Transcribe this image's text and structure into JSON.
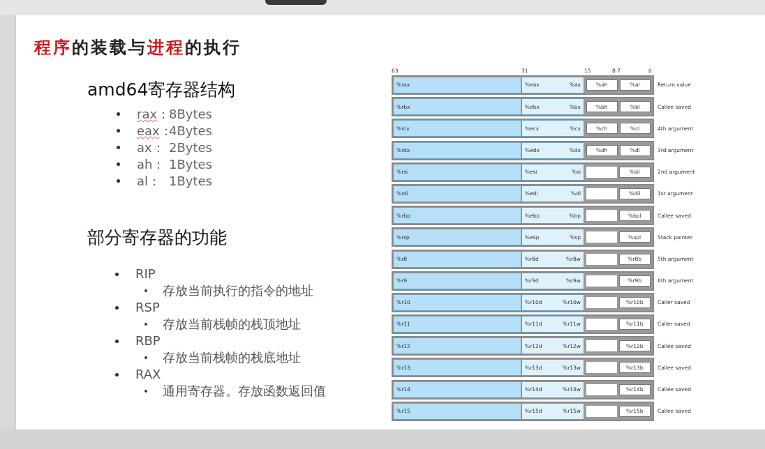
{
  "title": [
    {
      "text": "程序",
      "highlight": true
    },
    {
      "text": "的装载与",
      "highlight": false
    },
    {
      "text": "进程",
      "highlight": true
    },
    {
      "text": "的执行",
      "highlight": false
    }
  ],
  "section_1": {
    "heading": "amd64寄存器结构",
    "items": [
      {
        "name": "rax",
        "sep": "：",
        "value": "8Bytes",
        "misspelled": true
      },
      {
        "name": "eax",
        "sep": "：",
        "value": "4Bytes",
        "misspelled": true
      },
      {
        "name": "ax",
        "sep": "：",
        "value": "2Bytes",
        "misspelled": false
      },
      {
        "name": "ah",
        "sep": "：",
        "value": "1Bytes",
        "misspelled": false
      },
      {
        "name": "al",
        "sep": "：",
        "value": "1Bytes",
        "misspelled": false
      }
    ]
  },
  "section_2": {
    "heading": "部分寄存器的功能",
    "items": [
      {
        "label": "RIP",
        "children": [
          {
            "label": "存放当前执行的指令的地址"
          }
        ]
      },
      {
        "label": "RSP",
        "children": [
          {
            "label": "存放当前栈帧的栈顶地址"
          }
        ]
      },
      {
        "label": "RBP",
        "children": [
          {
            "label": "存放当前栈帧的栈底地址"
          }
        ]
      },
      {
        "label": "RAX",
        "children": [
          {
            "label": "通用寄存器。存放函数返回值"
          }
        ]
      }
    ]
  },
  "diagram": {
    "bit_labels": [
      "63",
      "31",
      "15",
      "8 7",
      "0"
    ],
    "rows": [
      {
        "r64": "%rax",
        "r32": "%eax",
        "r16": "%ax",
        "r8h": "%ah",
        "r8l": "%al",
        "note": "Return value"
      },
      {
        "r64": "%rbx",
        "r32": "%ebx",
        "r16": "%bx",
        "r8h": "%bh",
        "r8l": "%bl",
        "note": "Callee saved"
      },
      {
        "r64": "%rcx",
        "r32": "%ecx",
        "r16": "%cx",
        "r8h": "%ch",
        "r8l": "%cl",
        "note": "4th argument"
      },
      {
        "r64": "%rdx",
        "r32": "%edx",
        "r16": "%dx",
        "r8h": "%dh",
        "r8l": "%dl",
        "note": "3rd argument"
      },
      {
        "r64": "%rsi",
        "r32": "%esi",
        "r16": "%si",
        "r8l": "%sil",
        "note": "2nd argument"
      },
      {
        "r64": "%rdi",
        "r32": "%edi",
        "r16": "%di",
        "r8l": "%dil",
        "note": "1st argument"
      },
      {
        "r64": "%rbp",
        "r32": "%ebp",
        "r16": "%bp",
        "r8l": "%bpl",
        "note": "Callee saved"
      },
      {
        "r64": "%rsp",
        "r32": "%esp",
        "r16": "%sp",
        "r8l": "%spl",
        "note": "Stack pointer"
      },
      {
        "r64": "%r8",
        "r32": "%r8d",
        "r16": "%r8w",
        "r8l": "%r8b",
        "note": "5th argument"
      },
      {
        "r64": "%r9",
        "r32": "%r9d",
        "r16": "%r9w",
        "r8l": "%r9b",
        "note": "6th argument"
      },
      {
        "r64": "%r10",
        "r32": "%r10d",
        "r16": "%r10w",
        "r8l": "%r10b",
        "note": "Caller saved"
      },
      {
        "r64": "%r11",
        "r32": "%r11d",
        "r16": "%r11w",
        "r8l": "%r11b",
        "note": "Caller saved"
      },
      {
        "r64": "%r12",
        "r32": "%r12d",
        "r16": "%r12w",
        "r8l": "%r12b",
        "note": "Callee saved"
      },
      {
        "r64": "%r13",
        "r32": "%r13d",
        "r16": "%r13w",
        "r8l": "%r13b",
        "note": "Callee saved"
      },
      {
        "r64": "%r14",
        "r32": "%r14d",
        "r16": "%r14w",
        "r8l": "%r14b",
        "note": "Callee saved"
      },
      {
        "r64": "%r15",
        "r32": "%r15d",
        "r16": "%r15w",
        "r8l": "%r15b",
        "note": "Callee saved"
      }
    ]
  }
}
